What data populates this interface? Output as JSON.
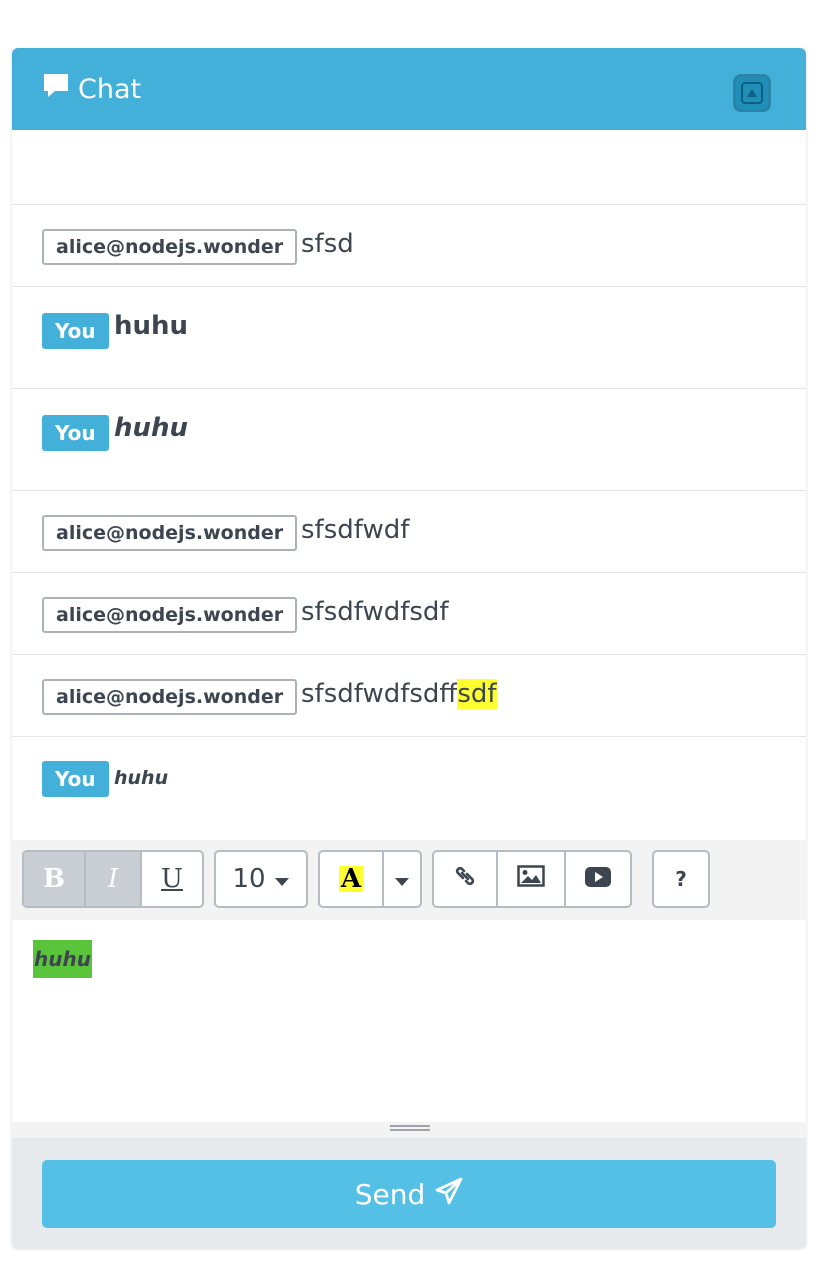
{
  "header": {
    "title": "Chat",
    "icon": "chat-bubble-icon",
    "collapse_icon": "collapse-up-icon"
  },
  "messages": [
    {
      "author": "alice@nodejs.wonder",
      "is_you": false,
      "text": "sfsd",
      "style": "normal"
    },
    {
      "author": "You",
      "is_you": true,
      "text": "huhu",
      "style": "bold"
    },
    {
      "author": "You",
      "is_you": true,
      "text": "huhu",
      "style": "bold-italic"
    },
    {
      "author": "alice@nodejs.wonder",
      "is_you": false,
      "text": "sfsdfwdf",
      "style": "normal"
    },
    {
      "author": "alice@nodejs.wonder",
      "is_you": false,
      "text": "sfsdfwdfsdf",
      "style": "normal"
    },
    {
      "author": "alice@nodejs.wonder",
      "is_you": false,
      "text_plain": "sfsdfwdfsdf",
      "text_highlight": "fsdf",
      "highlight_color": "#ffff30",
      "style": "normal"
    },
    {
      "author": "You",
      "is_you": true,
      "text": "huhu",
      "style": "bold-italic-small"
    }
  ],
  "toolbar": {
    "bold_label": "B",
    "italic_label": "I",
    "underline_label": "U",
    "font_size": "10",
    "font_color_label": "A",
    "font_color_highlight": "#ffff30",
    "help_label": "?"
  },
  "editor": {
    "content": "huhu",
    "highlight_color": "#5ac43a"
  },
  "send_button": {
    "label": "Send"
  },
  "colors": {
    "accent": "#42b0d9",
    "send": "#54c0e6"
  }
}
